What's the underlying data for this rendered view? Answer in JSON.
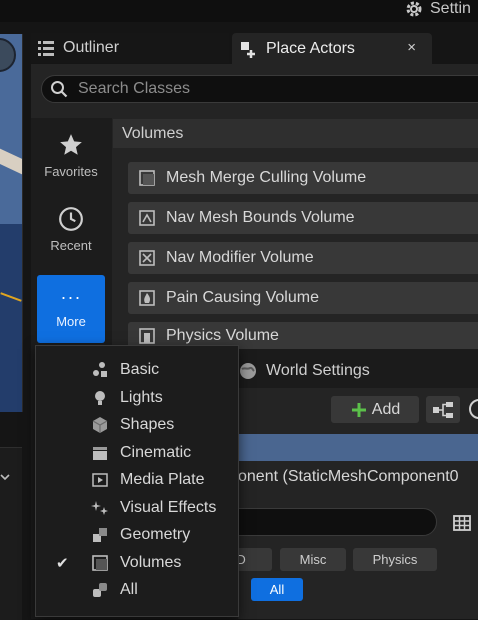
{
  "topbar": {
    "settings_label": "Settin"
  },
  "tabs": {
    "outliner_label": "Outliner",
    "place_actors_label": "Place Actors",
    "close_symbol": "×"
  },
  "search": {
    "placeholder": "Search Classes"
  },
  "categories": {
    "favorites": "Favorites",
    "recent": "Recent",
    "more": "More",
    "more_symbol": "···"
  },
  "volumes": {
    "header": "Volumes",
    "items": [
      "Mesh Merge Culling Volume",
      "Nav Mesh Bounds Volume",
      "Nav Modifier Volume",
      "Pain Causing Volume",
      "Physics Volume"
    ]
  },
  "menu": {
    "checked_item": "Volumes",
    "check_symbol": "✔",
    "items": [
      "Basic",
      "Lights",
      "Shapes",
      "Cinematic",
      "Media Plate",
      "Visual Effects",
      "Geometry",
      "Volumes",
      "All"
    ]
  },
  "details": {
    "world_settings_label": "World Settings",
    "add_label": "Add",
    "component_text": "onent (StaticMeshComponent0",
    "filters": {
      "lod": "OD",
      "misc": "Misc",
      "physics": "Physics",
      "all": "All"
    }
  },
  "colors": {
    "accent": "#0f6fe0",
    "selection": "#4a6690",
    "add_plus": "#5bc04a"
  }
}
